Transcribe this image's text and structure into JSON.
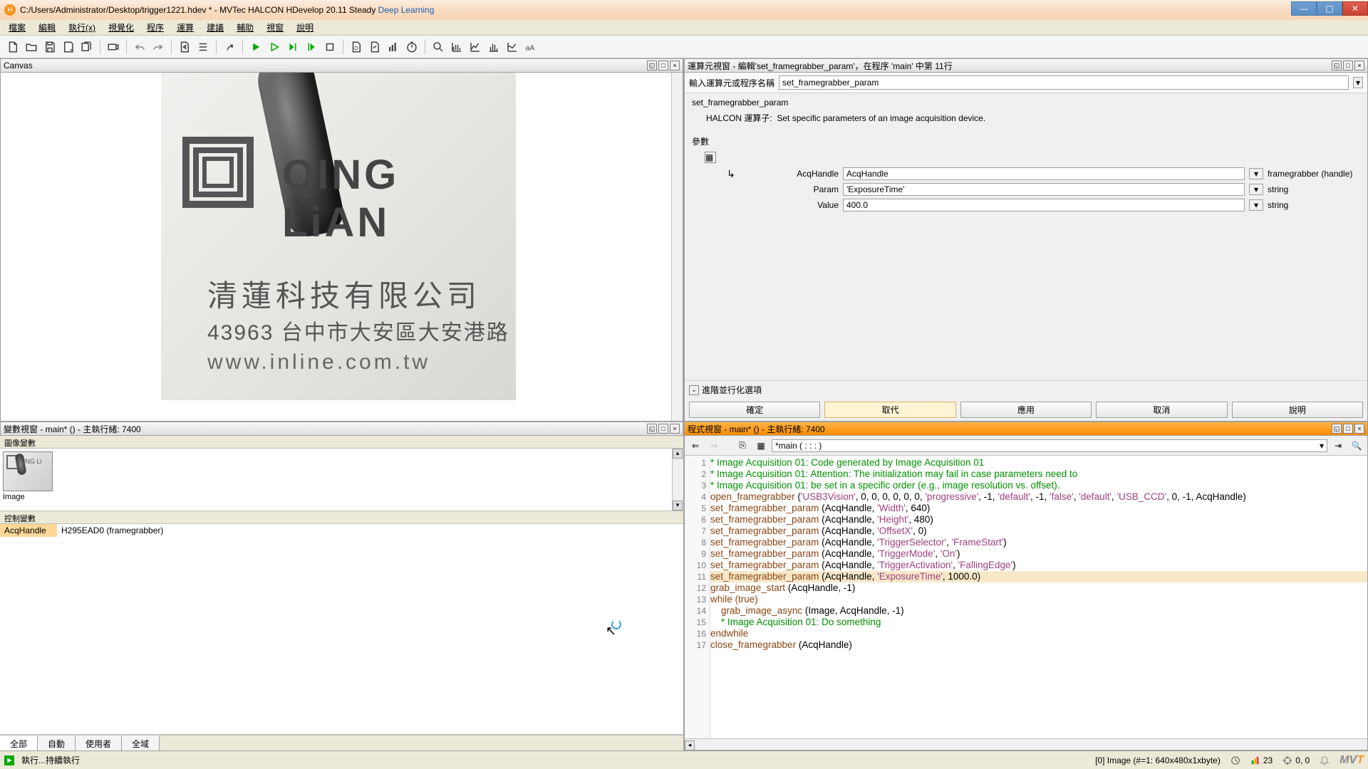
{
  "title": {
    "path": "C:/Users/Administrator/Desktop/trigger1221.hdev * - ",
    "app": "MVTec HALCON HDevelop 20.11 Steady",
    "dl": " Deep Learning"
  },
  "menu": [
    "檔案",
    "編輯",
    "執行(x)",
    "視覺化",
    "程序",
    "運算",
    "建議",
    "輔助",
    "視窗",
    "說明"
  ],
  "panels": {
    "canvas": "Canvas",
    "variables": "變數視窗 - main* () - 主執行緒: 7400",
    "operator": "運算元視窗 - 編輯'set_framegrabber_param'，在程序 'main' 中第 11行",
    "program": "程式視窗 - main* () - 主執行緒: 7400"
  },
  "canvas_image": {
    "brand_en": "QING LiAN",
    "brand_cn": "清蓮科技有限公司",
    "address": "43963 台中市大安區大安港路",
    "url": "www.inline.com.tw"
  },
  "vars": {
    "image_section": "圖像變數",
    "image_thumb_label": "Image",
    "control_section": "控制變數",
    "acq_name": "AcqHandle",
    "acq_value": "H295EAD0 (framegrabber)",
    "tabs": [
      "全部",
      "自動",
      "使用者",
      "全域"
    ]
  },
  "operator": {
    "input_label": "輸入運算元或程序名稱",
    "name_value": "set_framegrabber_param",
    "proc_title": "set_framegrabber_param",
    "halcon_label": "HALCON 運算子:",
    "desc": "Set specific parameters of an image acquisition device.",
    "params_title": "參數",
    "rows": [
      {
        "label": "AcqHandle",
        "value": "AcqHandle",
        "type": "framegrabber (handle)"
      },
      {
        "label": "Param",
        "value": "'ExposureTime'",
        "type": "string"
      },
      {
        "label": "Value",
        "value": "400.0",
        "type": "string"
      }
    ],
    "advanced": "進階並行化選項",
    "buttons": {
      "ok": "確定",
      "replace": "取代",
      "apply": "應用",
      "cancel": "取消",
      "help": "說明"
    }
  },
  "program": {
    "proc_name": "*main ( : : : )",
    "lines": [
      {
        "n": 1,
        "t": "comment",
        "text": "* Image Acquisition 01: Code generated by Image Acquisition 01"
      },
      {
        "n": 2,
        "t": "comment",
        "text": "* Image Acquisition 01: Attention: The initialization may fail in case parameters need to"
      },
      {
        "n": 3,
        "t": "comment",
        "text": "* Image Acquisition 01: be set in a specific order (e.g., image resolution vs. offset)."
      },
      {
        "n": 4,
        "t": "code",
        "op": "open_framegrabber",
        "args": " ('USB3Vision', 0, 0, 0, 0, 0, 0, 'progressive', -1, 'default', -1, 'false', 'default', 'USB_CCD', 0, -1, AcqHandle)"
      },
      {
        "n": 5,
        "t": "code",
        "op": "set_framegrabber_param",
        "args": " (AcqHandle, 'Width', 640)"
      },
      {
        "n": 6,
        "t": "code",
        "op": "set_framegrabber_param",
        "args": " (AcqHandle, 'Height', 480)"
      },
      {
        "n": 7,
        "t": "code",
        "op": "set_framegrabber_param",
        "args": " (AcqHandle, 'OffsetX', 0)"
      },
      {
        "n": 8,
        "t": "code",
        "op": "set_framegrabber_param",
        "args": " (AcqHandle, 'TriggerSelector', 'FrameStart')"
      },
      {
        "n": 9,
        "t": "code",
        "op": "set_framegrabber_param",
        "args": " (AcqHandle, 'TriggerMode', 'On')"
      },
      {
        "n": 10,
        "t": "code",
        "op": "set_framegrabber_param",
        "args": " (AcqHandle, 'TriggerActivation', 'FallingEdge')"
      },
      {
        "n": 11,
        "t": "code",
        "op": "set_framegrabber_param",
        "args": " (AcqHandle, 'ExposureTime', 1000.0)",
        "hl": true
      },
      {
        "n": 12,
        "t": "code",
        "op": "grab_image_start",
        "args": " (AcqHandle, -1)"
      },
      {
        "n": 13,
        "t": "kw",
        "text": "while (true)"
      },
      {
        "n": 14,
        "t": "code",
        "op": "    grab_image_async",
        "args": " (Image, AcqHandle, -1)",
        "pc": true
      },
      {
        "n": 15,
        "t": "comment",
        "text": "    * Image Acquisition 01: Do something"
      },
      {
        "n": 16,
        "t": "kw",
        "text": "endwhile"
      },
      {
        "n": 17,
        "t": "code",
        "op": "close_framegrabber",
        "args": " (AcqHandle)"
      }
    ]
  },
  "status": {
    "run": "執行...持續執行",
    "image_info": "[0] Image (#=1: 640x480x1xbyte)",
    "mem": "23",
    "coords": "0, 0"
  }
}
